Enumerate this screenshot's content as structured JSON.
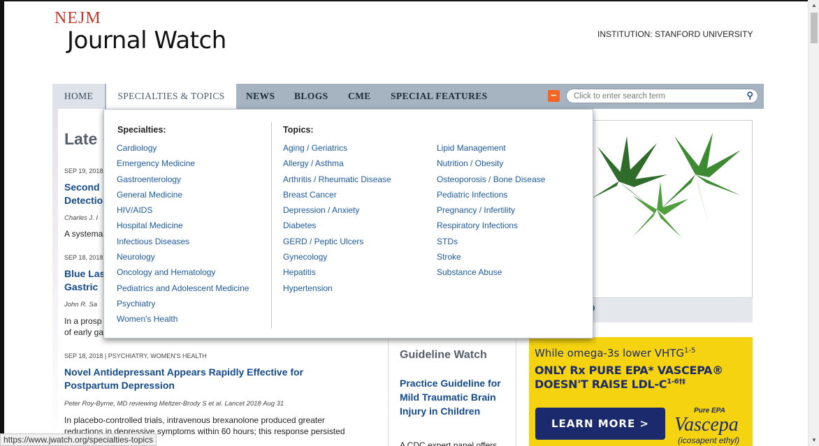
{
  "header": {
    "logo_top": "NEJM",
    "logo_main": "Journal Watch",
    "institution": "INSTITUTION: STANFORD UNIVERSITY"
  },
  "nav": {
    "items": [
      "HOME",
      "SPECIALTIES & TOPICS",
      "NEWS",
      "BLOGS",
      "CME",
      "SPECIAL FEATURES"
    ],
    "search_placeholder": "Click to enter search term"
  },
  "dropdown": {
    "specialties_heading": "Specialties:",
    "specialties": [
      "Cardiology",
      "Emergency Medicine",
      "Gastroenterology",
      "General Medicine",
      "HIV/AIDS",
      "Hospital Medicine",
      "Infectious Diseases",
      "Neurology",
      "Oncology and Hematology",
      "Pediatrics and Adolescent Medicine",
      "Psychiatry",
      "Women's Health"
    ],
    "topics_heading": "Topics:",
    "topics_col1": [
      "Aging / Geriatrics",
      "Allergy / Asthma",
      "Arthritis / Rheumatic Disease",
      "Breast Cancer",
      "Depression / Anxiety",
      "Diabetes",
      "GERD / Peptic Ulcers",
      "Gynecology",
      "Hepatitis",
      "Hypertension"
    ],
    "topics_col2": [
      "Lipid Management",
      "Nutrition / Obesity",
      "Osteoporosis / Bone Disease",
      "Pediatric Infections",
      "Pregnancy / Infertility",
      "Respiratory Infections",
      "STDs",
      "Stroke",
      "Substance Abuse"
    ]
  },
  "main": {
    "section_title": "Late",
    "articles": [
      {
        "date": "SEP 19, 2018",
        "title_line1": "Second",
        "title_line2": "Detectio",
        "author": "Charles J. I",
        "body_line1": "A systema"
      },
      {
        "date": "SEP 18, 2018",
        "title_line1": "Blue Las",
        "title_line2": "Gastric",
        "author": "John R. Sa",
        "body_line1": "In a prosp",
        "body_line2": "of early ga"
      },
      {
        "date": "SEP 18, 2018 | PSYCHIATRY, WOMEN'S HEALTH",
        "title_line1": "Novel Antidepressant Appears Rapidly Effective for",
        "title_line2": "Postpartum Depression",
        "author": "Peter Roy-Byrne, MD reviewing Meltzer-Brody S et al. Lancet 2018 Aug 31",
        "body_line1": "In placebo-controlled trials, intravenous brexanolone produced greater",
        "body_line2": "reductions in depressive symptoms within 60 hours; this response persisted"
      }
    ]
  },
  "guideline": {
    "title": "Guideline Watch",
    "link": "Practice Guideline for Mild Traumatic Brain Injury in Children",
    "body": "A CDC expert panel offers"
  },
  "photo_bar_text": "D",
  "ad": {
    "line1": "While omega-3s lower VHTG",
    "line1_sup": "1-5",
    "line2": "ONLY Rx PURE EPA* VASCEPA®",
    "line3": "DOESN'T RAISE LDL-C",
    "line3_sup": "1-6†‡",
    "button": "LEARN MORE  >",
    "pure": "Pure EPA",
    "brand": "Vascepa",
    "generic": "(icosapent ethyl)"
  },
  "status_bar": "https://www.jwatch.org/specialties-topics"
}
